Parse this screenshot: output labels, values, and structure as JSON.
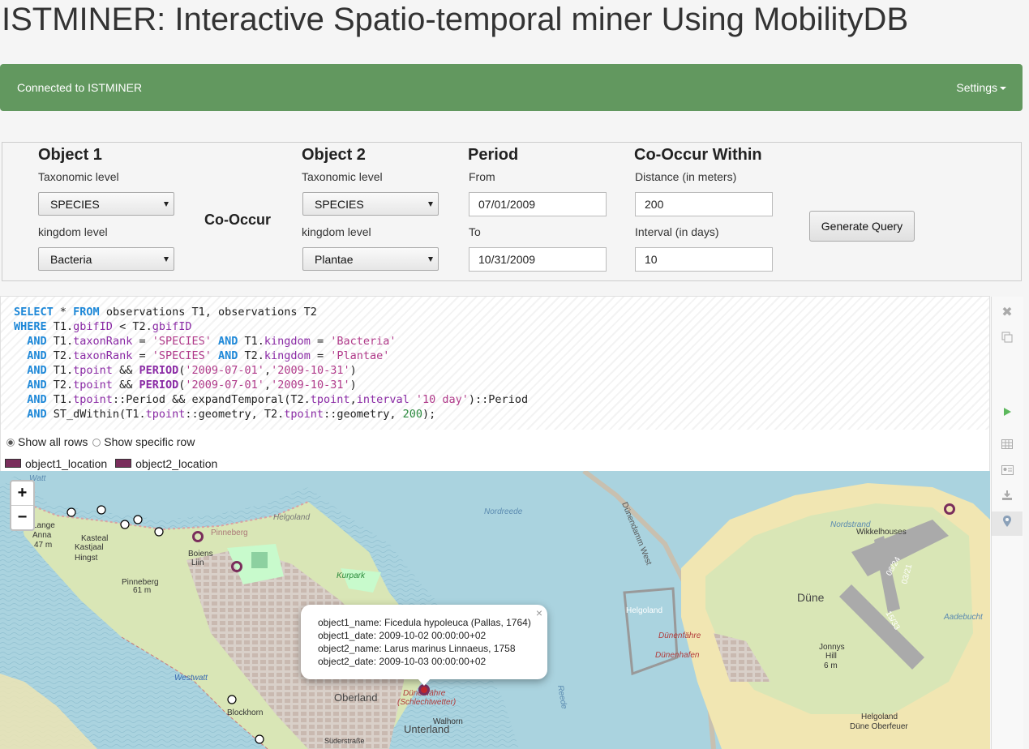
{
  "page": {
    "title": "ISTMINER: Interactive Spatio-temporal miner Using MobilityDB"
  },
  "navbar": {
    "status": "Connected to ISTMINER",
    "settings_label": "Settings"
  },
  "form": {
    "object1": {
      "heading": "Object 1",
      "taxonomic_label": "Taxonomic level",
      "taxonomic_value": "SPECIES",
      "kingdom_label": "kingdom level",
      "kingdom_value": "Bacteria"
    },
    "cooccur_label": "Co-Occur",
    "object2": {
      "heading": "Object 2",
      "taxonomic_label": "Taxonomic level",
      "taxonomic_value": "SPECIES",
      "kingdom_label": "kingdom level",
      "kingdom_value": "Plantae"
    },
    "period": {
      "heading": "Period",
      "from_label": "From",
      "from_value": "07/01/2009",
      "to_label": "To",
      "to_value": "10/31/2009"
    },
    "within": {
      "heading": "Co-Occur Within",
      "distance_label": "Distance (in meters)",
      "distance_value": "200",
      "interval_label": "Interval (in days)",
      "interval_value": "10"
    },
    "generate_label": "Generate Query"
  },
  "query_lines": [
    "SELECT * FROM observations T1, observations T2",
    "WHERE T1.gbifID < T2.gbifID",
    "  AND T1.taxonRank = 'SPECIES' AND T1.kingdom = 'Bacteria'",
    "  AND T2.taxonRank = 'SPECIES' AND T2.kingdom = 'Plantae'",
    "  AND T1.tpoint && PERIOD('2009-07-01','2009-10-31')",
    "  AND T2.tpoint && PERIOD('2009-07-01','2009-10-31')",
    "  AND T1.tpoint::Period && expandTemporal(T2.tpoint,interval '10 day')::Period",
    "  AND ST_dWithin(T1.tpoint::geometry, T2.tpoint::geometry, 200);"
  ],
  "result_options": {
    "show_all": "Show all rows",
    "show_specific": "Show specific row",
    "selected": "show_all"
  },
  "legend": [
    {
      "label": "object1_location",
      "color": "#7a2e5c"
    },
    {
      "label": "object2_location",
      "color": "#7a2e5c"
    }
  ],
  "sidebar_icons": [
    "close-icon",
    "copy-icon",
    "run-icon",
    "table-icon",
    "card-icon",
    "download-icon",
    "map-marker-icon"
  ],
  "map": {
    "zoom_in": "+",
    "zoom_out": "−",
    "labels": {
      "helgoland_top": "Helgoland",
      "pinneberg": "Pinneberg",
      "kasteal": "Kasteal",
      "kastjaal": "Kastjaal",
      "hingst": "Hingst",
      "boiens": "Boiens",
      "liin": "Liin",
      "pinneberg2": "Pinneberg",
      "m61": "61 m",
      "lange": "Lange",
      "anna": "Anna",
      "m47": "47 m",
      "kurpark": "Kurpark",
      "oberland": "Oberland",
      "unterland": "Unterland",
      "walhorn": "Walhorn",
      "westwatt": "Westwatt",
      "blockhorn": "Blockhorn",
      "duenenfaehre": "Dünenfähre",
      "schlechtwetter": "(Schlechtwetter)",
      "nordreede": "Nordreede",
      "reede": "Reede",
      "duene": "Düne",
      "nordstrand": "Nordstrand",
      "wikkelhouses": "Wikkelhouses",
      "jonnys_hill": "Jonnys",
      "hill": "Hill",
      "m6": "6 m",
      "duenenfaehre2": "Dünenfähre",
      "duenenhafen": "Dünenhafen",
      "helgoland_mid": "Helgoland",
      "helgoland_dune": "Helgoland",
      "dune_oberfeuer": "Düne Oberfeuer",
      "aadebucht": "Aadebucht",
      "runway1": "06/24",
      "runway2": "03/21",
      "runway3": "15/33",
      "dunendamm": "Dünendamm West",
      "watt": "Watt",
      "suederstrasse": "Süderstraße"
    },
    "popup": {
      "object1_name": "object1_name: Ficedula hypoleuca (Pallas, 1764)",
      "object1_date": "object1_date: 2009-10-02 00:00:00+02",
      "object2_name": "object2_name: Larus marinus Linnaeus, 1758",
      "object2_date": "object2_date: 2009-10-03 00:00:00+02",
      "close": "×"
    },
    "colors": {
      "sea": "#aad3df",
      "land": "#d8e8b8",
      "park": "#c8facc",
      "urban": "#d9d0c9",
      "sand": "#f1e6b2",
      "marker": "#7a2e5c"
    }
  }
}
